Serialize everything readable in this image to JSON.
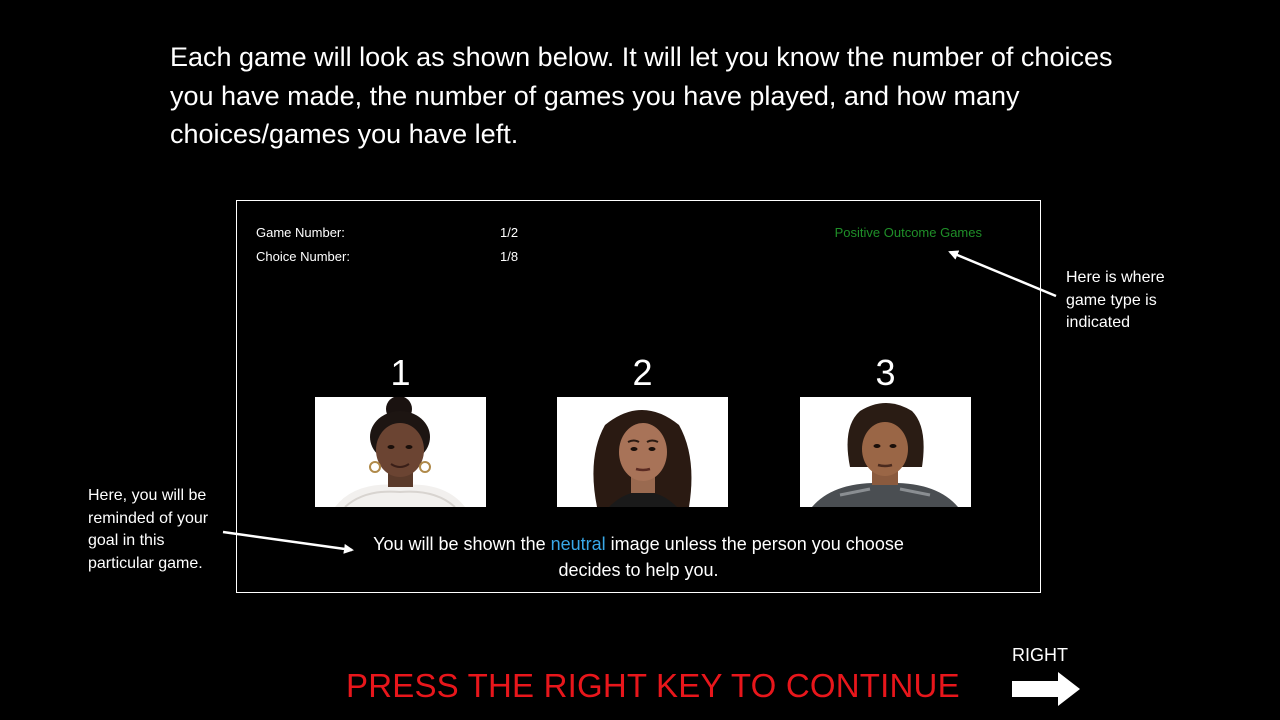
{
  "instructions": "Each game will look as shown below. It will let you know the number of choices you have made, the number of games you have played, and how many choices/games you have left.",
  "game": {
    "game_number_label": "Game Number:",
    "game_number_value": "1/2",
    "choice_number_label": "Choice Number:",
    "choice_number_value": "1/8",
    "game_type": "Positive Outcome Games",
    "choices": [
      {
        "number": "1"
      },
      {
        "number": "2"
      },
      {
        "number": "3"
      }
    ],
    "goal_before": "You will be shown the ",
    "goal_highlight": "neutral",
    "goal_after": " image unless the person you choose decides to help you."
  },
  "annotations": {
    "game_type_note": "Here is where game type is indicated",
    "goal_note": "Here, you will be reminded of your goal in this particular game."
  },
  "footer": {
    "continue_text": "PRESS THE RIGHT KEY TO CONTINUE",
    "right_key_label": "RIGHT"
  },
  "colors": {
    "background": "#000000",
    "game_type": "#1f8f28",
    "highlight": "#39a8e8",
    "continue": "#e8161b"
  }
}
